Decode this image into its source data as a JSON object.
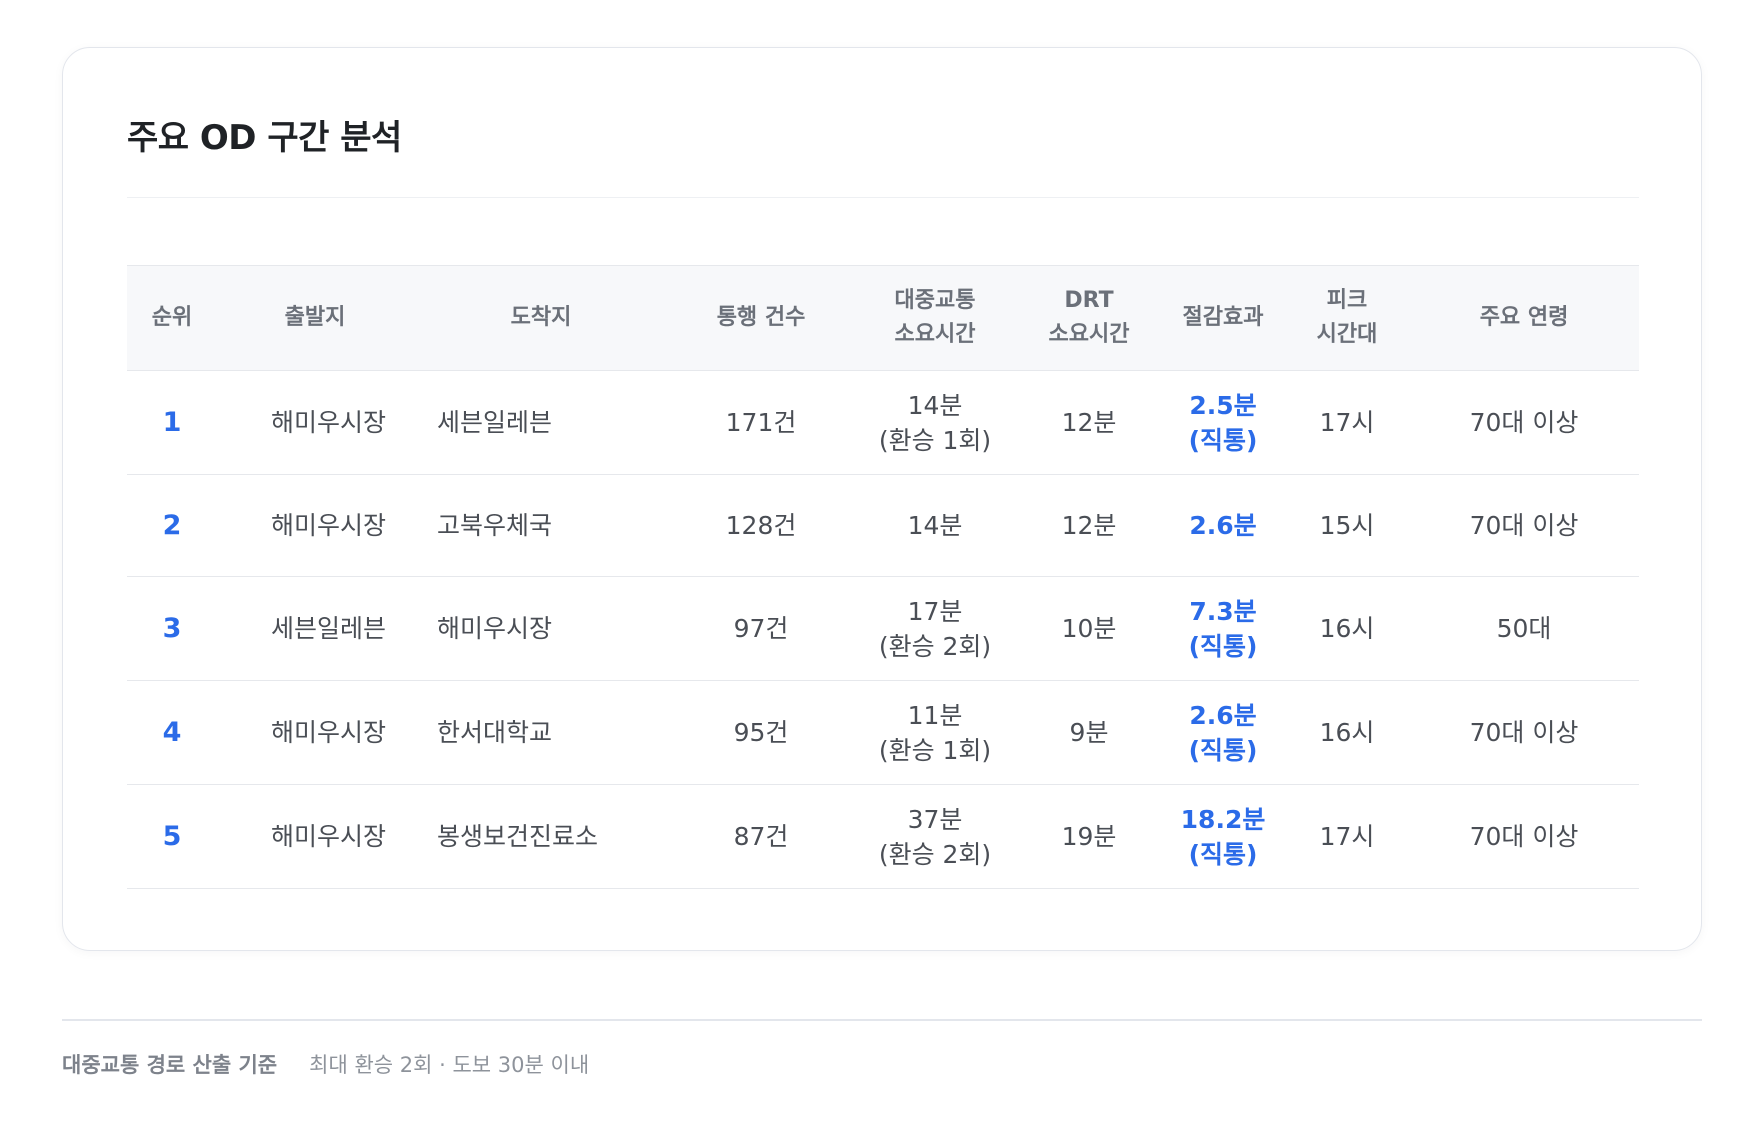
{
  "card": {
    "title": "주요 OD 구간 분석"
  },
  "table": {
    "headers": {
      "rank": "순위",
      "origin": "출발지",
      "destination": "도착지",
      "trips": "통행 건수",
      "transit_time_1": "대중교통",
      "transit_time_2": "소요시간",
      "drt_time_1": "DRT",
      "drt_time_2": "소요시간",
      "saving": "절감효과",
      "peak_1": "피크",
      "peak_2": "시간대",
      "age": "주요 연령"
    },
    "rows": [
      {
        "rank": "1",
        "origin": "해미우시장",
        "destination": "세븐일레븐",
        "trips": "171건",
        "transit_time": "14분",
        "transit_transfer": "(환승 1회)",
        "drt_time": "12분",
        "saving": "2.5분",
        "saving_note": "(직통)",
        "peak": "17시",
        "age": "70대 이상"
      },
      {
        "rank": "2",
        "origin": "해미우시장",
        "destination": "고북우체국",
        "trips": "128건",
        "transit_time": "14분",
        "transit_transfer": "",
        "drt_time": "12분",
        "saving": "2.6분",
        "saving_note": "",
        "peak": "15시",
        "age": "70대 이상"
      },
      {
        "rank": "3",
        "origin": "세븐일레븐",
        "destination": "해미우시장",
        "trips": "97건",
        "transit_time": "17분",
        "transit_transfer": "(환승 2회)",
        "drt_time": "10분",
        "saving": "7.3분",
        "saving_note": "(직통)",
        "peak": "16시",
        "age": "50대"
      },
      {
        "rank": "4",
        "origin": "해미우시장",
        "destination": "한서대학교",
        "trips": "95건",
        "transit_time": "11분",
        "transit_transfer": "(환승 1회)",
        "drt_time": "9분",
        "saving": "2.6분",
        "saving_note": "(직통)",
        "peak": "16시",
        "age": "70대 이상"
      },
      {
        "rank": "5",
        "origin": "해미우시장",
        "destination": "봉생보건진료소",
        "trips": "87건",
        "transit_time": "37분",
        "transit_transfer": "(환승 2회)",
        "drt_time": "19분",
        "saving": "18.2분",
        "saving_note": "(직통)",
        "peak": "17시",
        "age": "70대 이상"
      }
    ]
  },
  "footer": {
    "label": "대중교통 경로 산출 기준",
    "text": "최대 환승 2회 · 도보 30분 이내"
  },
  "colors": {
    "accent": "#2b6be8",
    "header_bg": "#f7f8fa",
    "border": "#e6e8ec",
    "title": "#1f2226"
  }
}
